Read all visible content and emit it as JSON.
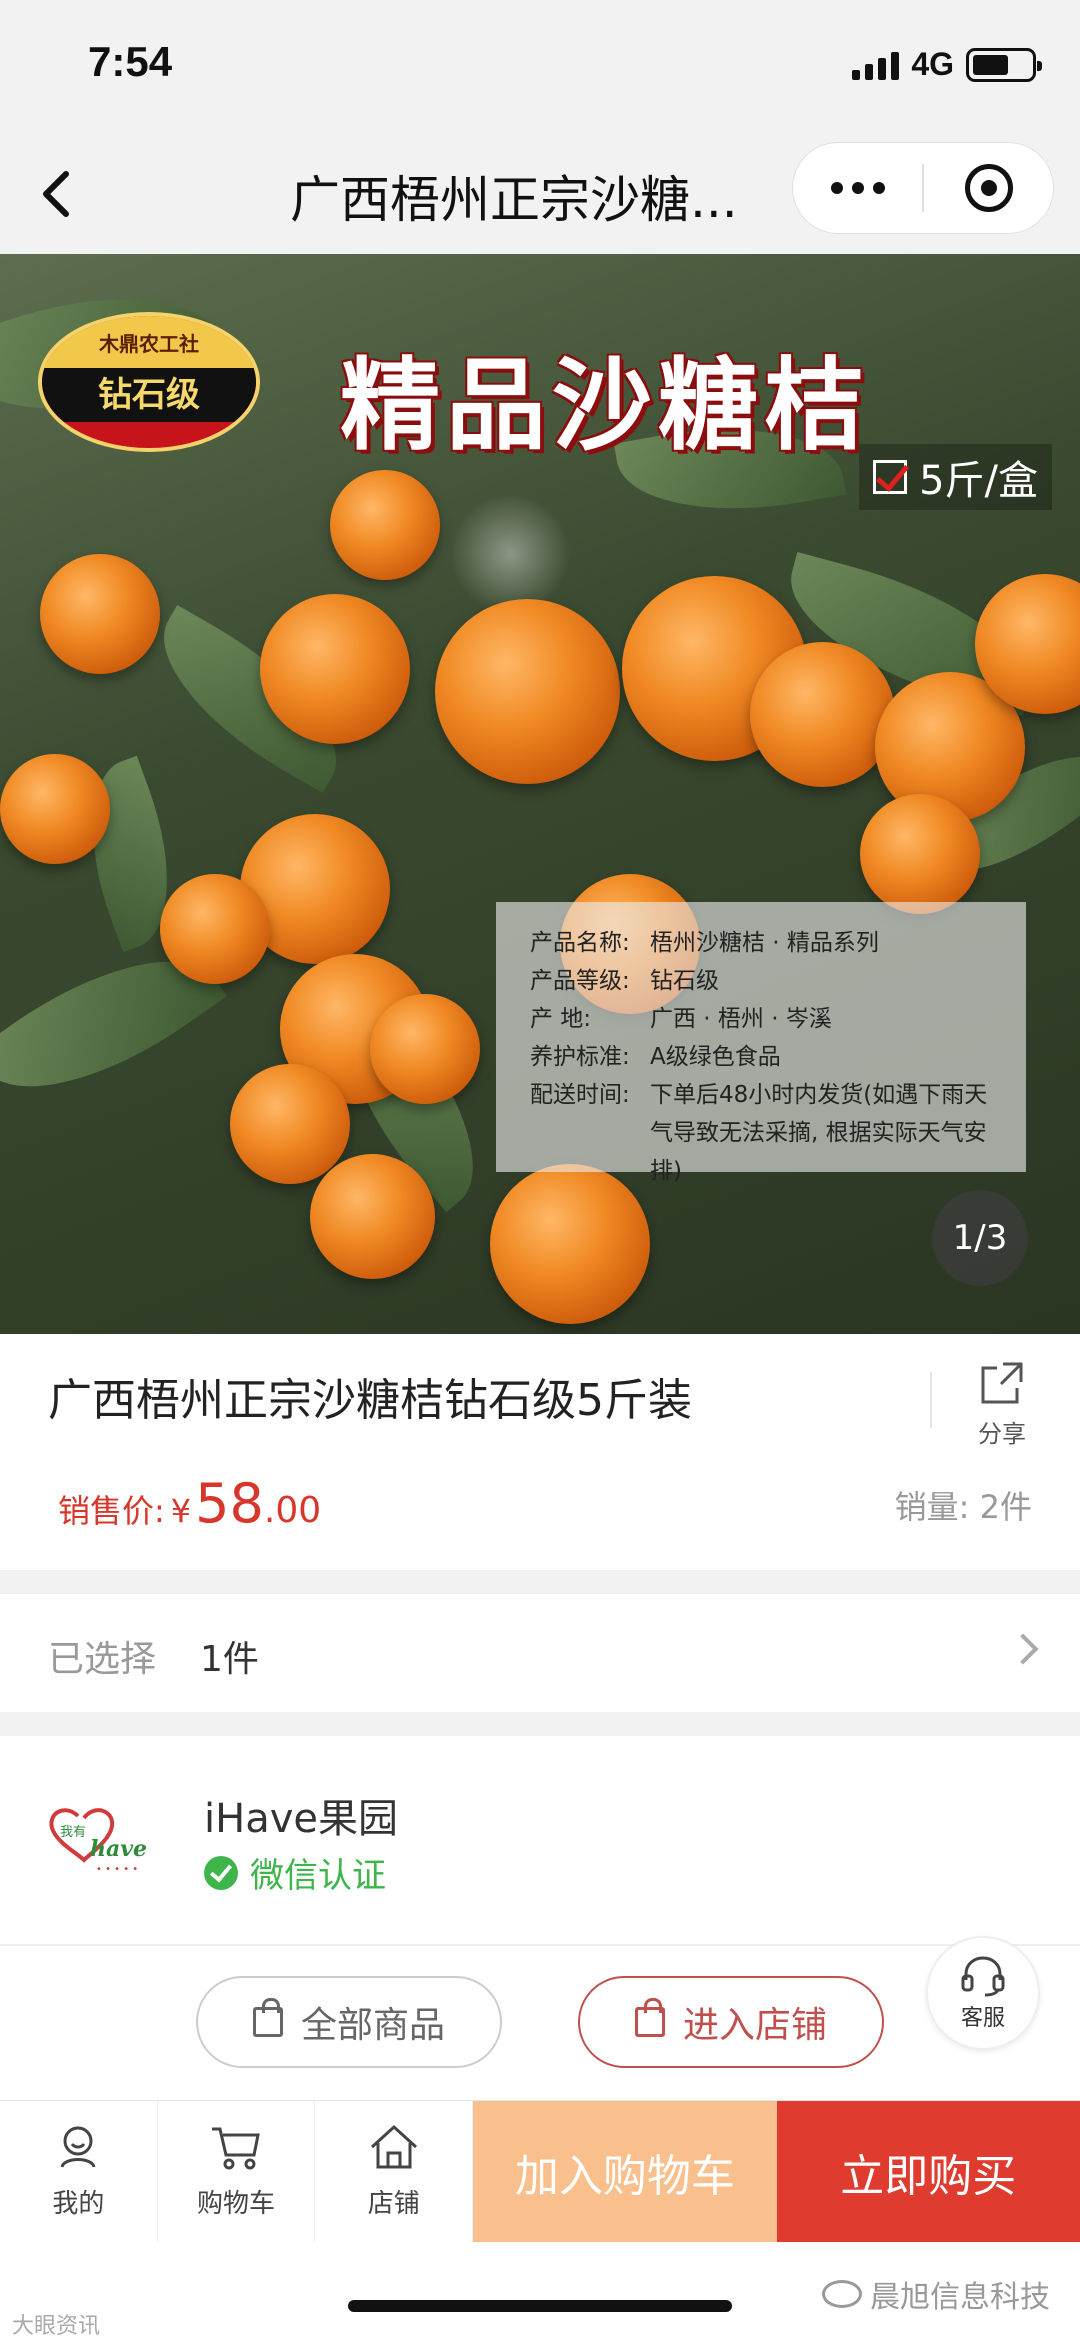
{
  "status_bar": {
    "time": "7:54",
    "network": "4G"
  },
  "nav": {
    "title": "广西梧州正宗沙糖..."
  },
  "hero": {
    "badge_top": "木鼎农工社",
    "badge_grade": "钻石级",
    "title": "精品沙糖桔",
    "spec": "5斤/盒",
    "info": [
      {
        "key": "产品名称:",
        "value": "梧州沙糖桔 · 精品系列"
      },
      {
        "key": "产品等级:",
        "value": "钻石级"
      },
      {
        "key": "产    地:",
        "value": "广西 · 梧州 · 岑溪"
      },
      {
        "key": "养护标准:",
        "value": "A级绿色食品"
      },
      {
        "key": "配送时间:",
        "value": "下单后48小时内发货(如遇下雨天气导致无法采摘, 根据实际天气安排)"
      }
    ],
    "pager": "1/3"
  },
  "product": {
    "title": "广西梧州正宗沙糖桔钻石级5斤装",
    "share_label": "分享",
    "price_label": "销售价:",
    "currency": "¥",
    "price_int": "58",
    "price_dec": ".00",
    "sales": "销量: 2件"
  },
  "selection": {
    "label": "已选择",
    "value": "1件"
  },
  "store": {
    "name": "iHave果园",
    "verified": "微信认证",
    "all_products": "全部商品",
    "enter_store": "进入店铺",
    "service": "客服"
  },
  "bottom_bar": {
    "tabs": [
      {
        "label": "我的",
        "icon": "user-icon"
      },
      {
        "label": "购物车",
        "icon": "cart-icon"
      },
      {
        "label": "店铺",
        "icon": "home-icon"
      }
    ],
    "add_to_cart": "加入购物车",
    "buy_now": "立即购买"
  },
  "watermarks": {
    "left": "大眼资讯",
    "right": "晨旭信息科技"
  },
  "colors": {
    "price": "#d9362b",
    "buy": "#df3b2f",
    "cart": "#f9c08d",
    "verified": "#3db54a"
  }
}
